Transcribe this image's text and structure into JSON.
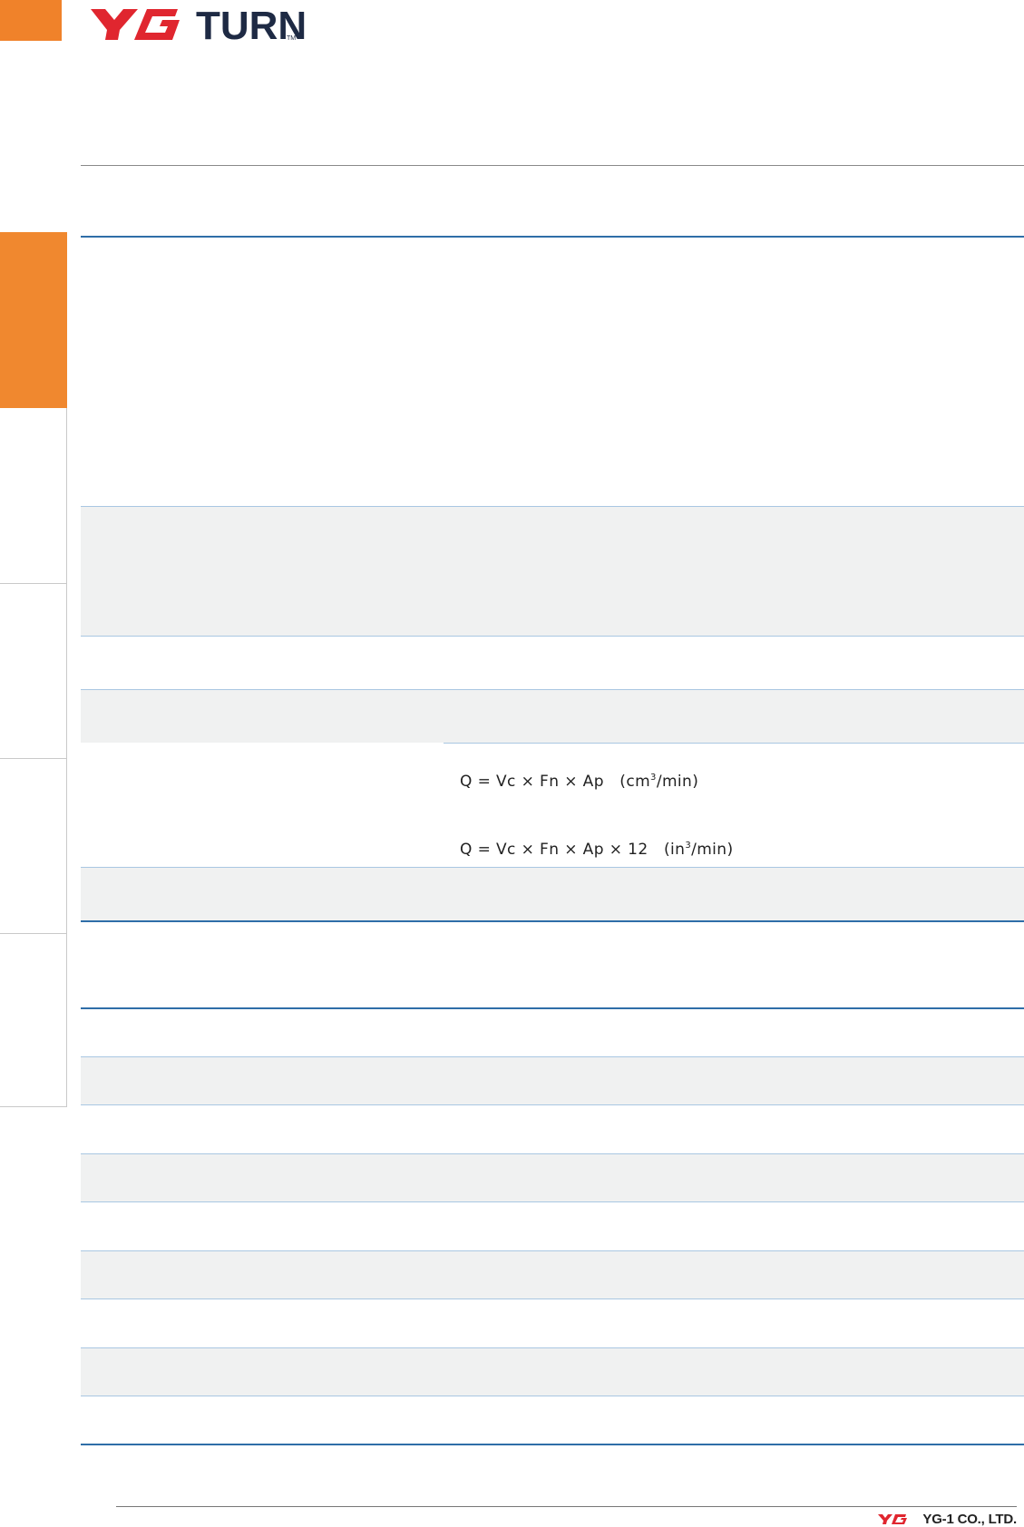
{
  "header": {
    "logo_mark": "YG",
    "logo_word": "TURN",
    "logo_tm": "TM"
  },
  "formulas": {
    "metric_prefix": "Q = Vc × Fn × Ap   (cm",
    "metric_sup": "3",
    "metric_suffix": "/min)",
    "inch_prefix": "Q = Vc × Fn × Ap × 12   (in",
    "inch_sup": "3",
    "inch_suffix": "/min)"
  },
  "footer": {
    "logo_mark": "YG",
    "company": "YG-1 CO., LTD."
  },
  "colors": {
    "accent_orange": "#f0822a",
    "brand_red": "#e0262f",
    "rule_blue": "#2f6ea8",
    "band_gray": "#f0f1f1"
  }
}
